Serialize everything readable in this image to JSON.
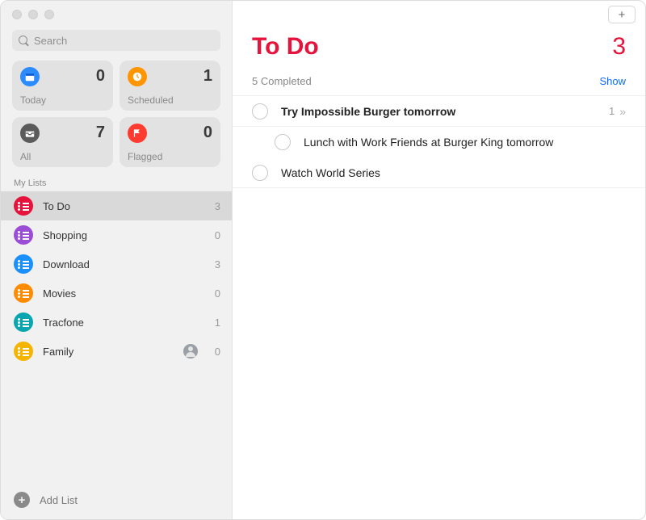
{
  "colors": {
    "accent": "#e6143c",
    "link": "#0a6cff"
  },
  "search": {
    "placeholder": "Search"
  },
  "cards": {
    "today": {
      "label": "Today",
      "count": 0
    },
    "scheduled": {
      "label": "Scheduled",
      "count": 1
    },
    "all": {
      "label": "All",
      "count": 7
    },
    "flagged": {
      "label": "Flagged",
      "count": 0
    }
  },
  "sections": {
    "mylists_header": "My Lists"
  },
  "lists": [
    {
      "name": "To Do",
      "count": 3,
      "color": "#e6143c",
      "selected": true,
      "shared": false
    },
    {
      "name": "Shopping",
      "count": 0,
      "color": "#9b4dd6",
      "selected": false,
      "shared": false
    },
    {
      "name": "Download",
      "count": 3,
      "color": "#1a90ff",
      "selected": false,
      "shared": false
    },
    {
      "name": "Movies",
      "count": 0,
      "color": "#ff8c00",
      "selected": false,
      "shared": false
    },
    {
      "name": "Tracfone",
      "count": 1,
      "color": "#0aa6b0",
      "selected": false,
      "shared": false
    },
    {
      "name": "Family",
      "count": 0,
      "color": "#f5b400",
      "selected": false,
      "shared": true
    }
  ],
  "footer": {
    "add_list_label": "Add List"
  },
  "main": {
    "title": "To Do",
    "count": 3,
    "completed_label": "5 Completed",
    "show_label": "Show",
    "items": [
      {
        "text": "Try Impossible Burger tomorrow",
        "bold": true,
        "sub": false,
        "subcount": 1,
        "has_children": true
      },
      {
        "text": "Lunch with Work Friends at Burger King tomorrow",
        "bold": false,
        "sub": true
      },
      {
        "text": "Watch World Series",
        "bold": false,
        "sub": false
      }
    ]
  },
  "toolbar": {
    "add_glyph": "+"
  }
}
